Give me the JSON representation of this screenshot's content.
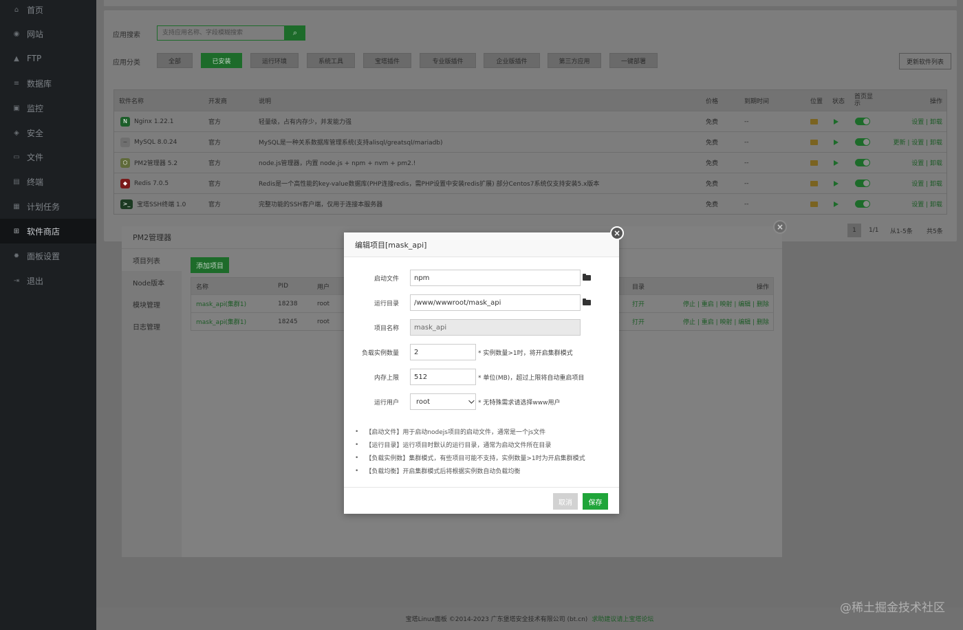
{
  "sidebar": {
    "items": [
      {
        "label": "首页",
        "icon": "home-icon"
      },
      {
        "label": "网站",
        "icon": "globe-icon"
      },
      {
        "label": "FTP",
        "icon": "ftp-icon"
      },
      {
        "label": "数据库",
        "icon": "database-icon"
      },
      {
        "label": "监控",
        "icon": "monitor-icon"
      },
      {
        "label": "安全",
        "icon": "shield-icon"
      },
      {
        "label": "文件",
        "icon": "folder-icon"
      },
      {
        "label": "终端",
        "icon": "terminal-icon"
      },
      {
        "label": "计划任务",
        "icon": "calendar-icon"
      },
      {
        "label": "软件商店",
        "icon": "grid-icon",
        "active": true
      },
      {
        "label": "面板设置",
        "icon": "settings-icon"
      },
      {
        "label": "退出",
        "icon": "logout-icon"
      }
    ]
  },
  "store": {
    "search_label": "应用搜索",
    "search_placeholder": "支持应用名称、字段模糊搜索",
    "category_label": "应用分类",
    "categories": [
      "全部",
      "已安装",
      "运行环境",
      "系统工具",
      "宝塔插件",
      "专业版插件",
      "企业版插件",
      "第三方应用",
      "一键部署"
    ],
    "active_category": "已安装",
    "update_button": "更新软件列表",
    "table_headers": {
      "name": "软件名称",
      "dev": "开发商",
      "desc": "说明",
      "price": "价格",
      "expire": "到期时间",
      "location": "位置",
      "status": "状态",
      "homepage": "首页显示",
      "ops": "操作"
    },
    "rows": [
      {
        "name": "Nginx 1.22.1",
        "dev": "官方",
        "desc": "轻量级，占有内存少，并发能力强",
        "price": "免费",
        "expire": "--",
        "ops": "设置 | 卸载",
        "icon_color": "#1c5e2a",
        "icon_text": "N"
      },
      {
        "name": "MySQL 8.0.24",
        "dev": "官方",
        "desc": "MySQL是一种关系数据库管理系统(支持alisql/greatsql/mariadb)",
        "price": "免费",
        "expire": "--",
        "ops": "更新 | 设置 | 卸载",
        "icon_color": "#6f6f6f",
        "icon_text": "~"
      },
      {
        "name": "PM2管理器 5.2",
        "dev": "官方",
        "desc": "node.js管理器，内置 node.js + npm + nvm + pm2.!",
        "price": "免费",
        "expire": "--",
        "ops": "设置 | 卸载",
        "icon_color": "#5f6a3a",
        "icon_text": "⬡"
      },
      {
        "name": "Redis 7.0.5",
        "dev": "官方",
        "desc": "Redis是一个高性能的key-value数据库(PHP连接redis，需PHP设置中安装redis扩展) 部分Centos7系统仅支持安装5.x版本",
        "price": "免费",
        "expire": "--",
        "ops": "设置 | 卸载",
        "icon_color": "#7a1b1b",
        "icon_text": "◆"
      },
      {
        "name": "宝塔SSH终端 1.0",
        "dev": "官方",
        "desc": "完整功能的SSH客户端，仅用于连接本服务器",
        "price": "免费",
        "expire": "--",
        "ops": "设置 | 卸载",
        "icon_color": "#1c3a22",
        "icon_text": ">_"
      }
    ],
    "pager": {
      "page": "1",
      "pages": "1/1",
      "range": "从1-5条",
      "total": "共5条"
    }
  },
  "pm2": {
    "title": "PM2管理器",
    "tabs": [
      "项目列表",
      "Node版本",
      "模块管理",
      "日志管理"
    ],
    "add_button": "添加项目",
    "headers": {
      "name": "名称",
      "pid": "PID",
      "user": "用户",
      "dir": "目录",
      "ops": "操作"
    },
    "rows": [
      {
        "name": "mask_api(集群1)",
        "pid": "18238",
        "user": "root",
        "dir": "打开",
        "ops": "停止 | 重启 | 映射 | 编辑 | 删除"
      },
      {
        "name": "mask_api(集群1)",
        "pid": "18245",
        "user": "root",
        "dir": "打开",
        "ops": "停止 | 重启 | 映射 | 编辑 | 删除"
      }
    ]
  },
  "dialog": {
    "title": "编辑项目[mask_api]",
    "fields": {
      "start_file": {
        "label": "启动文件",
        "value": "npm"
      },
      "run_dir": {
        "label": "运行目录",
        "value": "/www/wwwroot/mask_api"
      },
      "project_name": {
        "label": "项目名称",
        "value": "mask_api"
      },
      "instances": {
        "label": "负载实例数量",
        "value": "2",
        "hint": "* 实例数量>1时，将开启集群模式"
      },
      "memory": {
        "label": "内存上限",
        "value": "512",
        "hint": "* 单位(MB)，超过上限将自动重启项目"
      },
      "run_user": {
        "label": "运行用户",
        "value": "root",
        "hint": "* 无特殊需求请选择www用户"
      }
    },
    "tips": [
      "【启动文件】用于启动nodejs项目的启动文件，通常是一个js文件",
      "【运行目录】运行项目时默认的运行目录，通常为启动文件所在目录",
      "【负载实例数】集群模式，有些项目可能不支持，实例数量>1时为开启集群模式",
      "【负载均衡】开启集群模式后将根据实例数自动负载均衡"
    ],
    "cancel": "取消",
    "save": "保存"
  },
  "footer": {
    "text": "宝塔Linux面板 ©2014-2023 广东堡塔安全技术有限公司 (bt.cn)",
    "link": "求助建议请上宝塔论坛"
  },
  "watermark": "@稀土掘金技术社区",
  "colors": {
    "accent": "#20a53a",
    "sidebar": "#1c1f22"
  }
}
